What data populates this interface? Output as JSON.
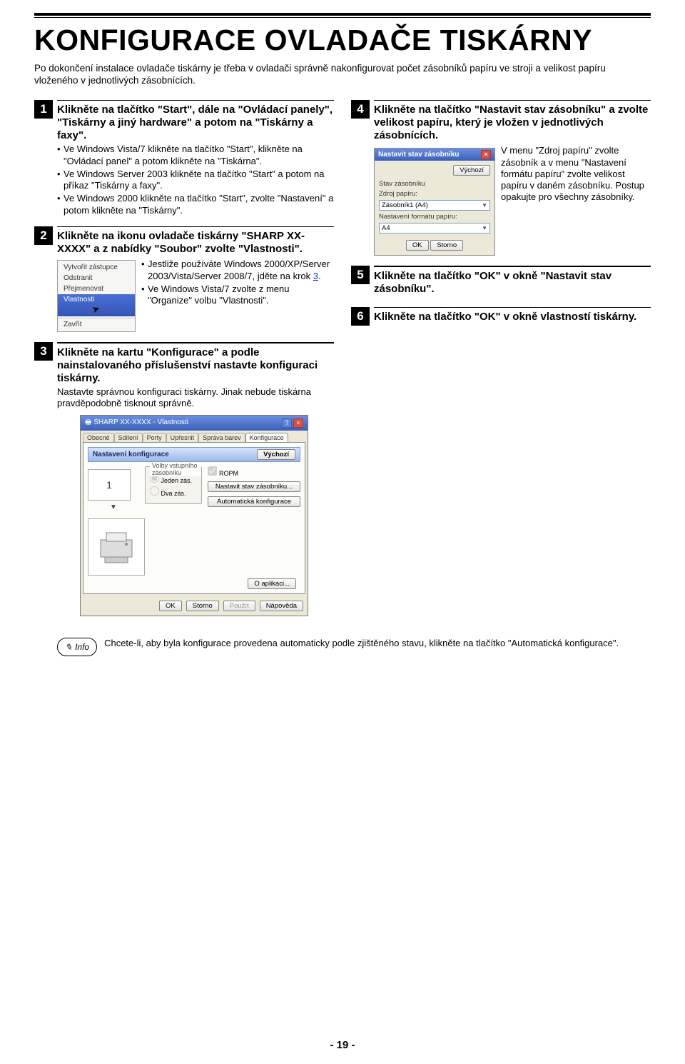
{
  "title": "KONFIGURACE OVLADAČE TISKÁRNY",
  "intro": "Po dokončení instalace ovladače tiskárny je třeba v ovladači správně nakonfigurovat počet zásobníků papíru ve stroji a velikost papíru vloženého v jednotlivých zásobnících.",
  "steps": {
    "s1": {
      "num": "1",
      "head": "Klikněte na tlačítko \"Start\", dále na \"Ovládací panely\", \"Tiskárny a jiný hardware\" a potom na \"Tiskárny a faxy\".",
      "b1": "Ve Windows Vista/7 klikněte na tlačítko \"Start\", klikněte na \"Ovládací panel\" a potom klikněte na \"Tiskárna\".",
      "b2": "Ve Windows Server 2003 klikněte na tlačítko \"Start\" a potom na příkaz \"Tiskárny a faxy\".",
      "b3": "Ve Windows 2000 klikněte na tlačítko \"Start\", zvolte \"Nastavení\" a potom klikněte na \"Tiskárny\"."
    },
    "s2": {
      "num": "2",
      "head": "Klikněte na ikonu ovladače tiskárny \"SHARP XX-XXXX\" a z nabídky \"Soubor\" zvolte \"Vlastnosti\".",
      "b1": "Jestliže používáte Windows 2000/XP/Server 2003/Vista/Server 2008/7, jděte na krok 3.",
      "b2": "Ve Windows Vista/7 zvolte z menu \"Organize\" volbu \"Vlastnosti\".",
      "ctx": {
        "i1": "Vytvořit zástupce",
        "i2": "Odstranit",
        "i3": "Přejmenovat",
        "i4": "Vlastnosti",
        "i5": "Zavřít"
      }
    },
    "s3": {
      "num": "3",
      "head": "Klikněte na kartu \"Konfigurace\" a podle nainstalovaného příslušenství nastavte konfiguraci tiskárny.",
      "text": "Nastavte správnou konfiguraci tiskárny. Jinak nebude tiskárna pravděpodobně tisknout správně.",
      "dialog": {
        "title": "SHARP XX-XXXX - Vlastnosti",
        "tabs": {
          "t1": "Obecné",
          "t2": "Sdílení",
          "t3": "Porty",
          "t4": "Upřesnit",
          "t5": "Správa barev",
          "t6": "Konfigurace"
        },
        "panel_head": "Nastavení konfigurace",
        "btn_default": "Výchozí",
        "group": "Volby vstupního zásobníku",
        "r1": "Jeden zás.",
        "r2": "Dva zás.",
        "ropm": "ROPM",
        "btn_tray": "Nastavit stav zásobníku...",
        "btn_auto": "Automatická konfigurace",
        "one": "1",
        "about": "O aplikaci...",
        "ok": "OK",
        "cancel": "Storno",
        "apply": "Použít",
        "help": "Nápověda"
      }
    },
    "s4": {
      "num": "4",
      "head": "Klikněte na tlačítko \"Nastavit stav zásobníku\" a zvolte velikost papíru, který je vložen v jednotlivých zásobnících.",
      "text": "V menu \"Zdroj papíru\" zvolte zásobník a v menu \"Nastavení formátu papíru\" zvolte velikost papíru v daném zásobníku. Postup opakujte pro všechny zásobníky.",
      "dialog": {
        "title": "Nastavit stav zásobníku",
        "btn_default": "Výchozí",
        "lbl_state": "Stav zásobníku",
        "lbl_src": "Zdroj papíru:",
        "val_src": "Zásobník1 (A4)",
        "lbl_fmt": "Nastavení formátu papíru:",
        "val_fmt": "A4",
        "ok": "OK",
        "cancel": "Storno"
      }
    },
    "s5": {
      "num": "5",
      "head": "Klikněte na tlačítko \"OK\" v okně \"Nastavit stav zásobníku\"."
    },
    "s6": {
      "num": "6",
      "head": "Klikněte na tlačítko \"OK\" v okně vlastností tiskárny."
    }
  },
  "info": {
    "label": "Info",
    "text": "Chcete-li, aby byla konfigurace provedena automaticky podle zjištěného stavu, klikněte na tlačítko \"Automatická konfigurace\"."
  },
  "page_number": "- 19 -"
}
